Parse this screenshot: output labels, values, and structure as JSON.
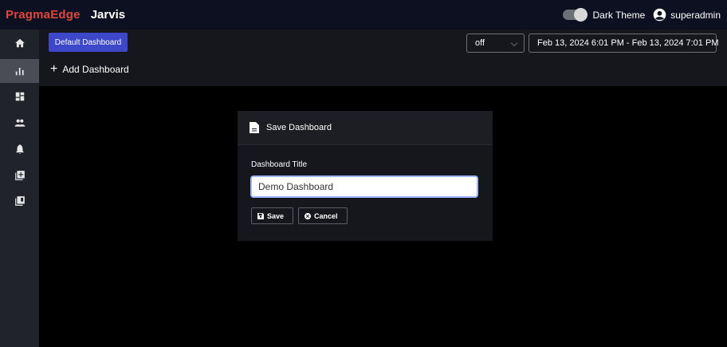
{
  "topbar": {
    "brand": "PragmaEdge",
    "app_name": "Jarvis",
    "theme_label": "Dark Theme",
    "user_name": "superadmin",
    "dark_theme_on": true
  },
  "sidebar": {
    "items": [
      {
        "icon": "home-icon",
        "active": false
      },
      {
        "icon": "bar-chart-icon",
        "active": true
      },
      {
        "icon": "dashboard-icon",
        "active": false
      },
      {
        "icon": "users-icon",
        "active": false
      },
      {
        "icon": "alert-bell-icon",
        "active": false
      },
      {
        "icon": "add-panel-icon",
        "active": false
      },
      {
        "icon": "library-icon",
        "active": false
      }
    ]
  },
  "header": {
    "dashboard_tab": "Default Dashboard",
    "refresh_value": "off",
    "date_range": "Feb 13, 2024 6:01 PM - Feb 13, 2024 7:01 PM",
    "add_dashboard_label": "Add Dashboard"
  },
  "modal": {
    "title": "Save Dashboard",
    "field_label": "Dashboard Title",
    "field_value": "Demo Dashboard",
    "save_label": "Save",
    "cancel_label": "Cancel"
  },
  "colors": {
    "brand": "#e0463b",
    "accent": "#3d47c9",
    "topbar_bg": "#0d1021"
  }
}
